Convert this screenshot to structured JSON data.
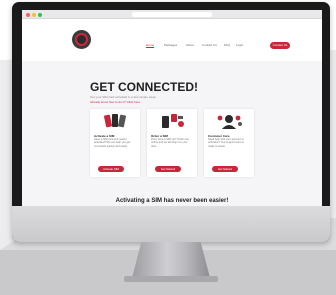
{
  "browser": {
    "url": ""
  },
  "site": {
    "nav": [
      {
        "label": "Home",
        "active": true
      },
      {
        "label": "Packages",
        "active": false
      },
      {
        "label": "About",
        "active": false
      },
      {
        "label": "Contact Us",
        "active": false
      },
      {
        "label": "FAQ",
        "active": false
      },
      {
        "label": "Login",
        "active": false
      }
    ],
    "nav_cta": "Contact Us"
  },
  "hero": {
    "title": "GET CONNECTED!",
    "subtitle": "Get your SIM card activated in a few simple steps",
    "link": "Already know how to do it?  Click here"
  },
  "cards": [
    {
      "title": "Activate a SIM",
      "text": "Have a SIM card and need it activated? We can help you get connected quickly and easily.",
      "note": "",
      "button": "Activate SIM"
    },
    {
      "title": "Order a SIM",
      "text": "Don't have a SIM yet? Order one online and we will ship it to your door.",
      "note": "",
      "button": "Get Started"
    },
    {
      "title": "Customer Care",
      "text": "Need help with your account or activation? Our support team is ready to assist.",
      "note": "",
      "button": "Get Started"
    }
  ],
  "footer_tagline": "Activating a SIM has never been easier!",
  "colors": {
    "brand": "#c8273a",
    "screen_bg": "#f5f5f7",
    "bezel": "#1a1a1a"
  }
}
